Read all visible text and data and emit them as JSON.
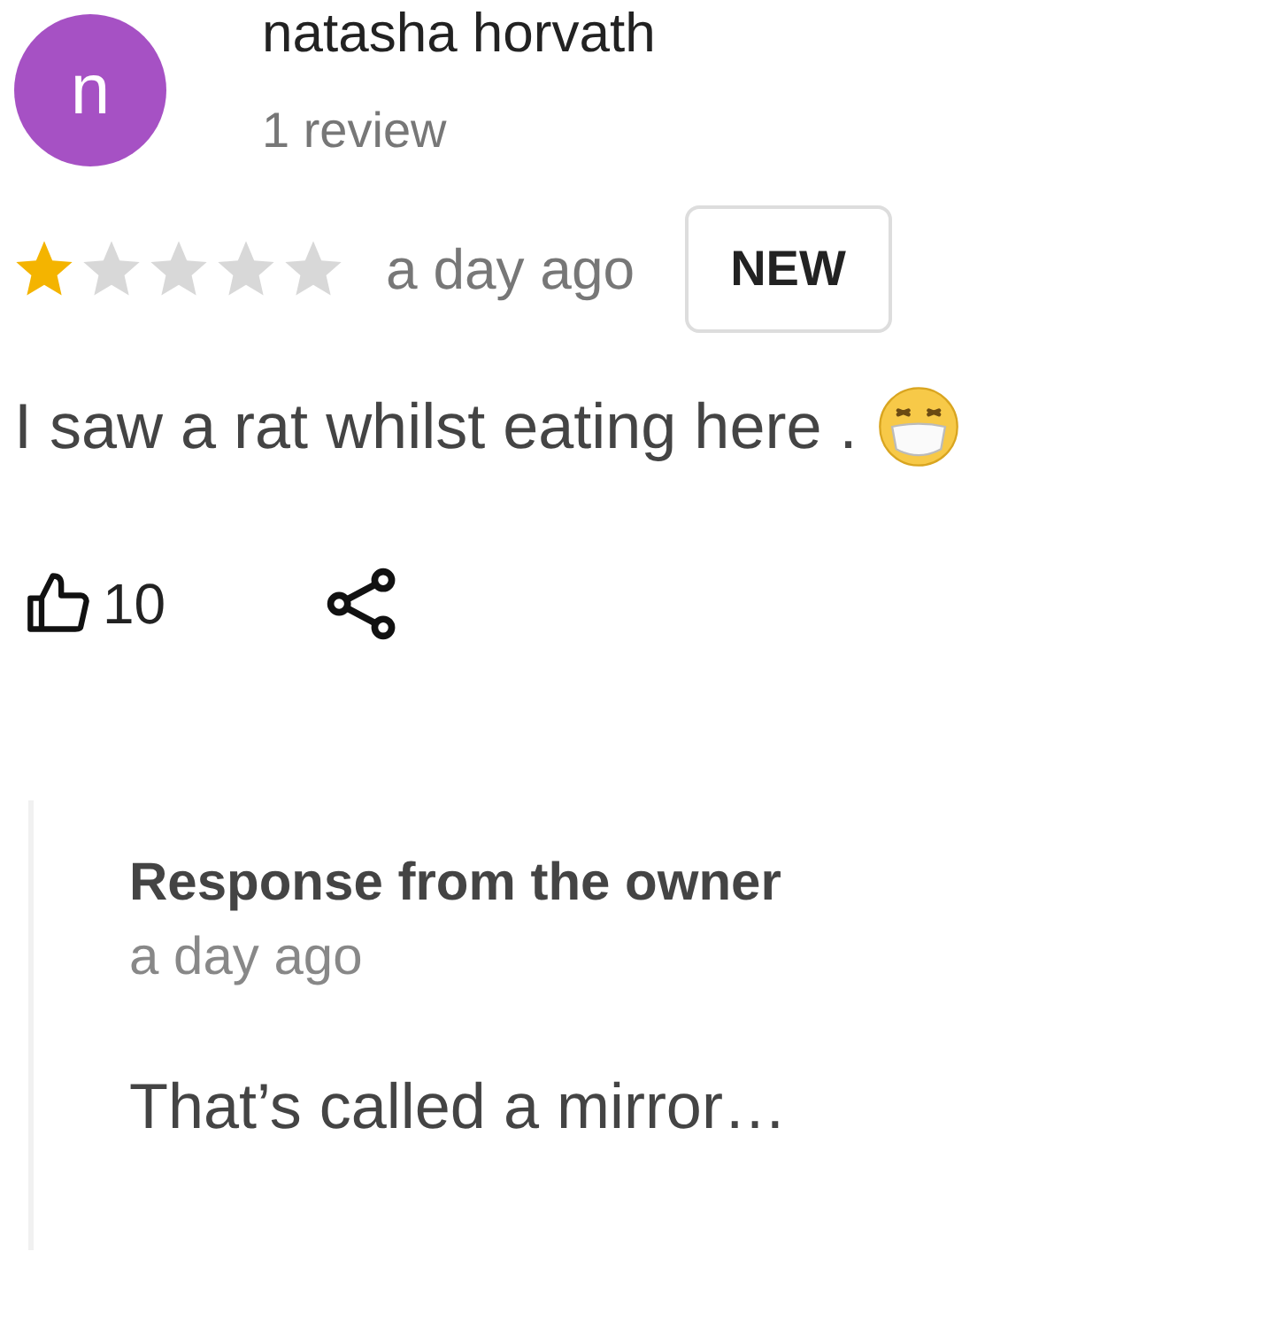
{
  "review": {
    "avatar_letter": "n",
    "author": "natasha horvath",
    "author_meta": "1 review",
    "stars": 1,
    "time": "a day ago",
    "badge": "NEW",
    "text": "I saw a rat whilst eating here .",
    "likes": "10"
  },
  "owner_response": {
    "title": "Response from the owner",
    "time": "a day ago",
    "text": "That’s called a mirror…"
  }
}
